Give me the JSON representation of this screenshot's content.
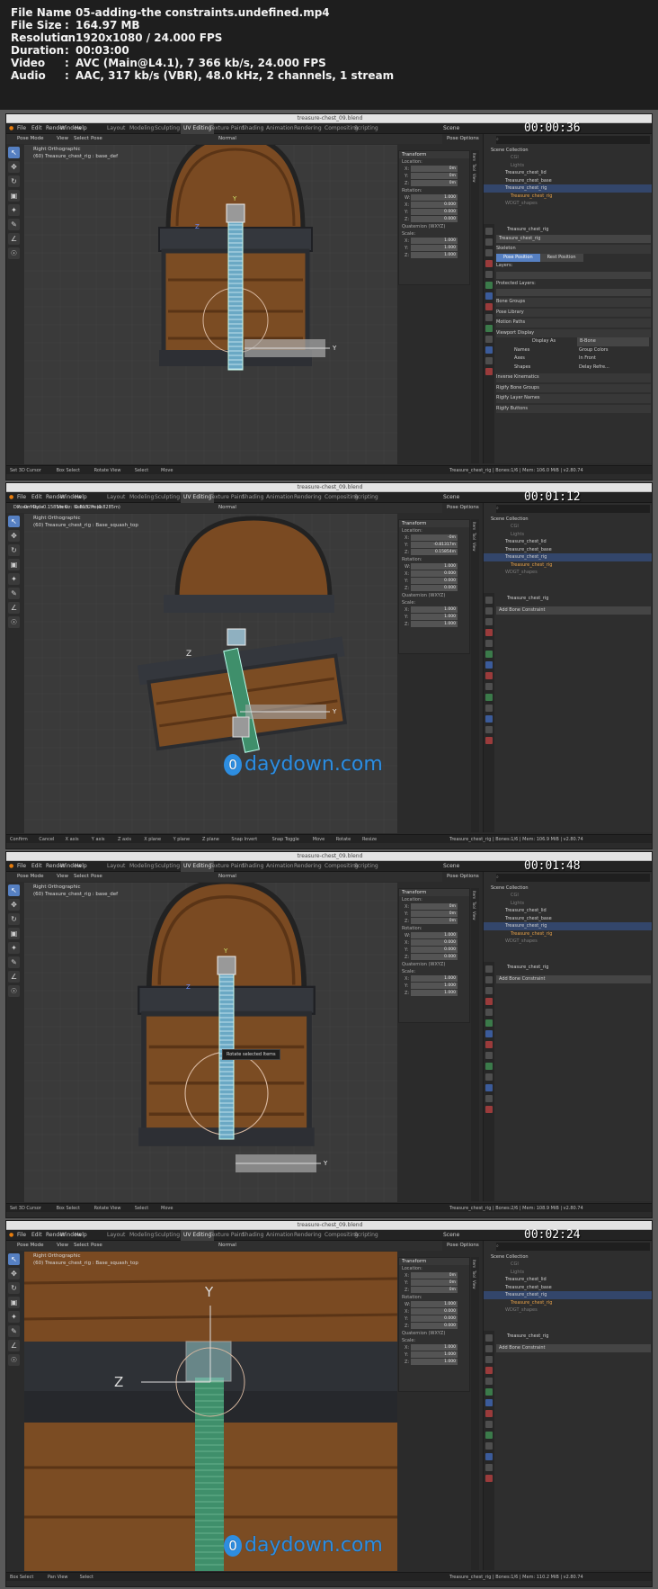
{
  "header": {
    "rows": [
      {
        "key": "File Name",
        "value": "05-adding-the constraints.undefined.mp4"
      },
      {
        "key": "File Size",
        "value": "164.97 MB"
      },
      {
        "key": "Resolution",
        "value": "1920x1080 / 24.000 FPS"
      },
      {
        "key": "Duration",
        "value": "00:03:00"
      },
      {
        "key": "Video",
        "value": "AVC (Main@L4.1), 7 366 kb/s, 24.000 FPS"
      },
      {
        "key": "Audio",
        "value": "AAC, 317 kb/s (VBR), 48.0 kHz, 2 channels, 1 stream"
      }
    ]
  },
  "common": {
    "window_title": "treasure-chest_09.blend",
    "menus": [
      "File",
      "Edit",
      "Render",
      "Window",
      "Help"
    ],
    "workspaces": [
      "Layout",
      "Modeling",
      "Sculpting",
      "UV Editing",
      "Texture Paint",
      "Shading",
      "Animation",
      "Rendering",
      "Compositing",
      "Scripting"
    ],
    "scene_label": "Scene",
    "pose_options": "Pose Options",
    "mode": "Pose Mode",
    "view_menus": [
      "View",
      "Select",
      "Pose"
    ],
    "transform_orientation": "Normal",
    "view_label": "Right Orthographic",
    "transform_title": "Transform",
    "location_label": "Location:",
    "rotation_label": "Rotation:",
    "rotation_mode": "4L",
    "quaternion_label": "Quaternion (WXYZ)",
    "scale_label": "Scale:",
    "axis": [
      "X:",
      "Y:",
      "Z:",
      "W:"
    ],
    "sidebar_tabs": [
      "Item",
      "Tool",
      "View"
    ],
    "outliner_items": [
      {
        "label": "Scene Collection",
        "style": "normal"
      },
      {
        "label": "CGI",
        "style": "dim"
      },
      {
        "label": "Lights",
        "style": "dim"
      },
      {
        "label": "Treasure_chest_lid",
        "style": "normal"
      },
      {
        "label": "Treasure_chest_base",
        "style": "normal"
      },
      {
        "label": "Treasure_chest_rig",
        "style": "sel"
      },
      {
        "label": "Treasure_chest_rig",
        "style": "orange"
      },
      {
        "label": "WDGT_shapes",
        "style": "dim"
      }
    ],
    "rig_name": "Treasure_chest_rig",
    "armature_field": "Treasure_chest_rig",
    "add_bone_constraint": "Add Bone Constraint",
    "status_version": "v2.80.74"
  },
  "frames": [
    {
      "timestamp": "00:00:36",
      "bone_label": "(60) Treasure_chest_rig : base_def",
      "location": [
        "0m",
        "0m",
        "0m"
      ],
      "rotation": [
        "1.000",
        "0.000",
        "0.000",
        "0.000"
      ],
      "scale": [
        "1.000",
        "1.000",
        "1.000"
      ],
      "skeleton": {
        "title": "Skeleton",
        "pose_position": "Pose Position",
        "rest_position": "Rest Position",
        "layers": "Layers:",
        "protected_layers": "Protected Layers:",
        "sections": [
          "Bone Groups",
          "Pose Library",
          "Motion Paths",
          "Viewport Display"
        ],
        "display_as_label": "Display As",
        "display_as_value": "B-Bone",
        "names": "Names",
        "group_colors": "Group Colors",
        "axes": "Axes",
        "in_front": "In Front",
        "shapes": "Shapes",
        "delay_refresh": "Delay Refre...",
        "more_sections": [
          "Inverse Kinematics",
          "Rigify Bone Groups",
          "Rigify Layer Names",
          "Rigify Buttons"
        ]
      },
      "status": [
        "Set 3D Cursor",
        "Box Select",
        "Rotate View",
        "Select",
        "Move"
      ],
      "status_right": "Treasure_chest_rig | Bones:1/6 | Mem: 106.0 MiB | v2.80.74"
    },
    {
      "timestamp": "00:01:12",
      "bone_label": "(60) Treasure_chest_rig : Base_squash_top",
      "header_readout": "Dx: -0m  Dy: -0.1585m  Dz: -0.8132m (0.8285m)",
      "location": [
        "-0m",
        "-0.81317m",
        "0.15854m"
      ],
      "rotation": [
        "1.000",
        "0.000",
        "0.000",
        "0.000"
      ],
      "scale": [
        "1.000",
        "1.000",
        "1.000"
      ],
      "status": [
        "Confirm",
        "Cancel",
        "X axis",
        "Y axis",
        "Z axis",
        "X plane",
        "Y plane",
        "Z plane",
        "Snap Invert",
        "Snap Toggle",
        "Move",
        "Rotate",
        "Resize"
      ],
      "status_right": "Treasure_chest_rig | Bones:1/6 | Mem: 106.9 MiB | v2.80.74",
      "watermark": "daydown.com"
    },
    {
      "timestamp": "00:01:48",
      "bone_label": "(60) Treasure_chest_rig : base_def",
      "location": [
        "0m",
        "0m",
        "0m"
      ],
      "rotation": [
        "1.000",
        "0.000",
        "0.000",
        "0.000"
      ],
      "scale": [
        "1.000",
        "1.000",
        "1.000"
      ],
      "tooltip": "Rotate selected Items",
      "status": [
        "Set 3D Cursor",
        "Box Select",
        "Rotate View",
        "Select",
        "Move"
      ],
      "status_right": "Treasure_chest_rig | Bones:2/6 | Mem: 108.9 MiB | v2.80.74"
    },
    {
      "timestamp": "00:02:24",
      "bone_label": "(60) Treasure_chest_rig : Base_squash_top",
      "location": [
        "0m",
        "0m",
        "0m"
      ],
      "rotation": [
        "1.000",
        "0.000",
        "0.000",
        "0.000"
      ],
      "scale": [
        "1.000",
        "1.000",
        "1.000"
      ],
      "status": [
        "Box Select",
        "Pan View",
        "Select"
      ],
      "status_right": "Treasure_chest_rig | Bones:1/6 | Mem: 110.2 MiB | v2.80.74",
      "watermark": "daydown.com"
    }
  ]
}
